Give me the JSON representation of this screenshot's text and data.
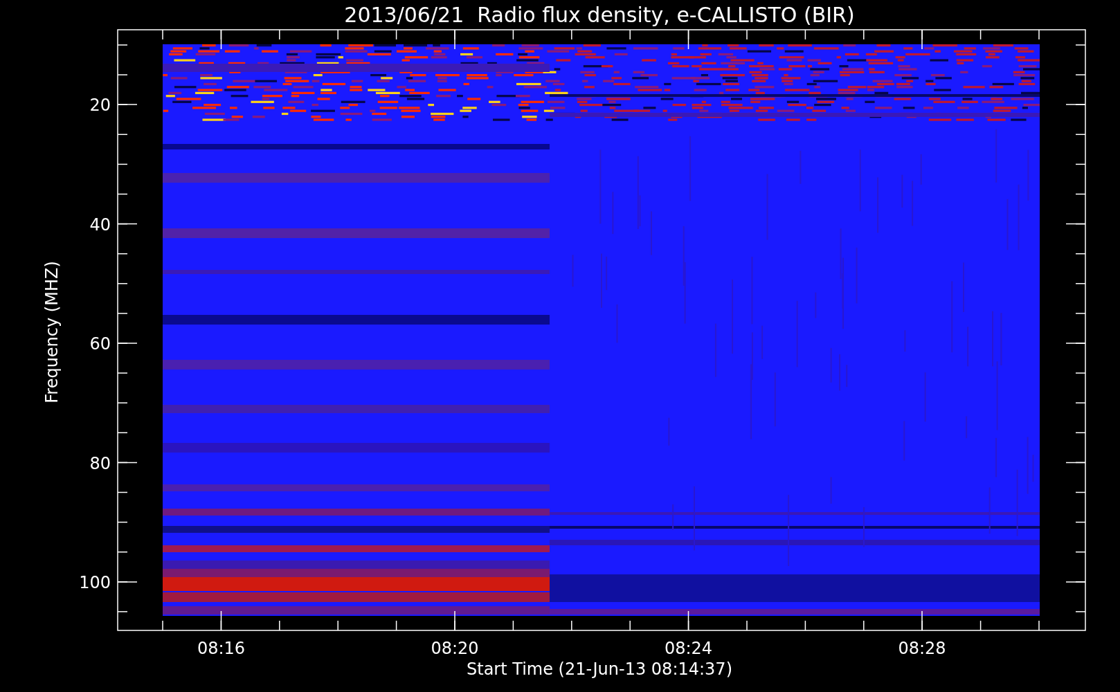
{
  "plot": {
    "title": "2013/06/21  Radio flux density, e-CALLISTO (BIR)",
    "ylabel": "Frequency (MHZ)",
    "xlabel": "Start Time (21-Jun-13 08:14:37)",
    "yticks": [
      "20",
      "40",
      "60",
      "80",
      "100"
    ],
    "xticks": [
      "08:16",
      "08:20",
      "08:24",
      "08:28"
    ]
  }
}
